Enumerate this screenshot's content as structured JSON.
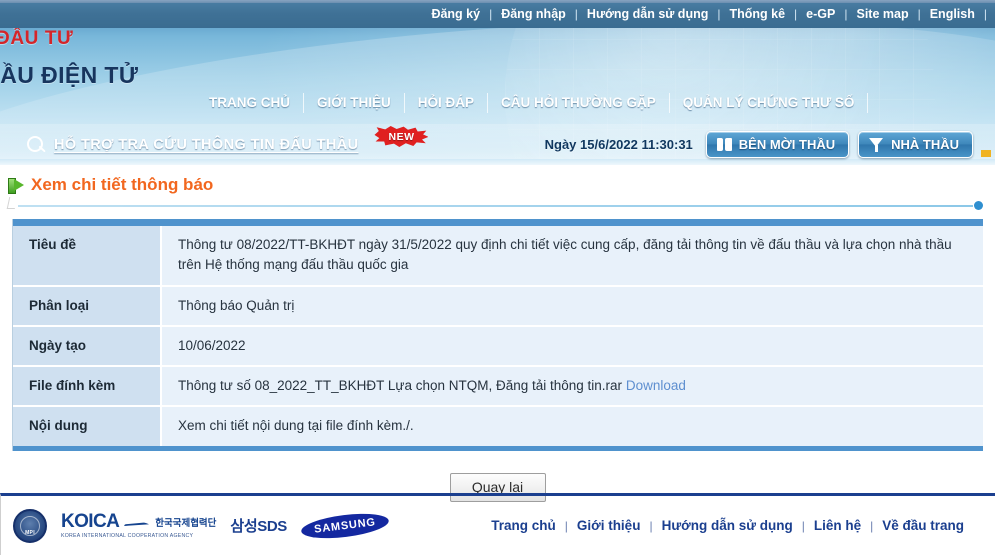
{
  "header": {
    "top_nav": [
      {
        "label": "Đăng ký"
      },
      {
        "label": "Đăng nhập"
      },
      {
        "label": "Hướng dẫn sử dụng"
      },
      {
        "label": "Thống kê"
      },
      {
        "label": "e-GP"
      },
      {
        "label": "Site map"
      },
      {
        "label": "English"
      }
    ],
    "logo": {
      "line1": "CH VÀ ĐẦU TƯ",
      "line2": "ẤU THẦU ĐIỆN TỬ",
      "line1_color": "#d4252a",
      "line2_color": "#17355e"
    },
    "main_nav": [
      {
        "label": "TRANG CHỦ"
      },
      {
        "label": "GIỚI THIỆU"
      },
      {
        "label": "HỎI ĐÁP"
      },
      {
        "label": "CÂU HỎI THƯỜNG GẶP"
      },
      {
        "label": "QUẢN LÝ CHỨNG THƯ SỐ"
      }
    ],
    "support": {
      "link_text": "HỖ TRỢ TRA CỨU THÔNG TIN ĐẤU THẦU",
      "badge": "NEW",
      "badge_color": "#e02020",
      "datetime": "Ngày 15/6/2022 11:30:31",
      "buttons": [
        {
          "label": "BÊN MỜI THẦU",
          "icon": "book-icon"
        },
        {
          "label": "NHÀ THẦU",
          "icon": "funnel-icon"
        }
      ]
    }
  },
  "page": {
    "title": "Xem chi tiết thông báo",
    "title_color": "#f2671f"
  },
  "detail": {
    "rows": [
      {
        "label": "Tiêu đề",
        "value": "Thông tư 08/2022/TT-BKHĐT ngày 31/5/2022 quy định chi tiết việc cung cấp, đăng tải thông tin về đấu thầu và lựa chọn nhà thầu trên Hệ thống mạng đấu thầu quốc gia"
      },
      {
        "label": "Phân loại",
        "value": "Thông báo Quản trị"
      },
      {
        "label": "Ngày tạo",
        "value": "10/06/2022"
      },
      {
        "label": "File đính kèm",
        "value": "Thông tư số 08_2022_TT_BKHĐT Lựa chọn NTQM, Đăng tải thông tin.rar",
        "link_label": "Download",
        "link_color": "#5e8fd0"
      },
      {
        "label": "Nội dung",
        "value": "Xem chi tiết nội dung tại file đính kèm./."
      }
    ]
  },
  "actions": {
    "back_label": "Quay lại"
  },
  "footer": {
    "logos": [
      {
        "name": "mpi-seal",
        "text": "MPI"
      },
      {
        "name": "koica-logo",
        "word": "KOICA",
        "korean": "한국국제협력단",
        "subtitle": "KOREA INTERNATIONAL COOPERATION AGENCY"
      },
      {
        "name": "samsung-sds-logo",
        "text": "삼성SDS"
      },
      {
        "name": "samsung-logo",
        "text": "SAMSUNG"
      }
    ],
    "links": [
      {
        "label": "Trang chủ"
      },
      {
        "label": "Giới thiệu"
      },
      {
        "label": "Hướng dẫn sử dụng"
      },
      {
        "label": "Liên hệ"
      },
      {
        "label": "Về đầu trang"
      }
    ]
  }
}
